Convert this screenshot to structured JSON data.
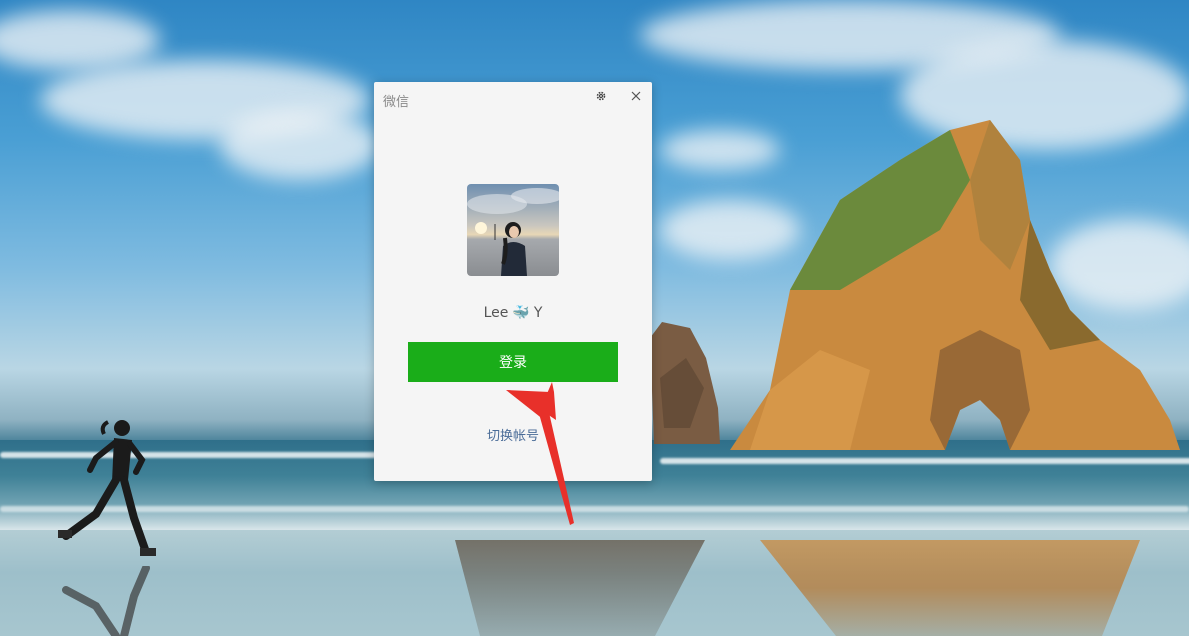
{
  "window": {
    "title": "微信",
    "settings_icon": "gear-icon",
    "close_icon": "close-icon"
  },
  "profile": {
    "avatar": "avatar-photo",
    "name_prefix": "Lee",
    "name_emoji": "🐳",
    "name_suffix": "Y"
  },
  "login_button": {
    "label": "登录",
    "color": "#1aad19"
  },
  "switch_account": {
    "label": "切换帐号",
    "color": "#4a6c98"
  },
  "annotation": {
    "type": "red-arrow",
    "color": "#e8302a"
  }
}
